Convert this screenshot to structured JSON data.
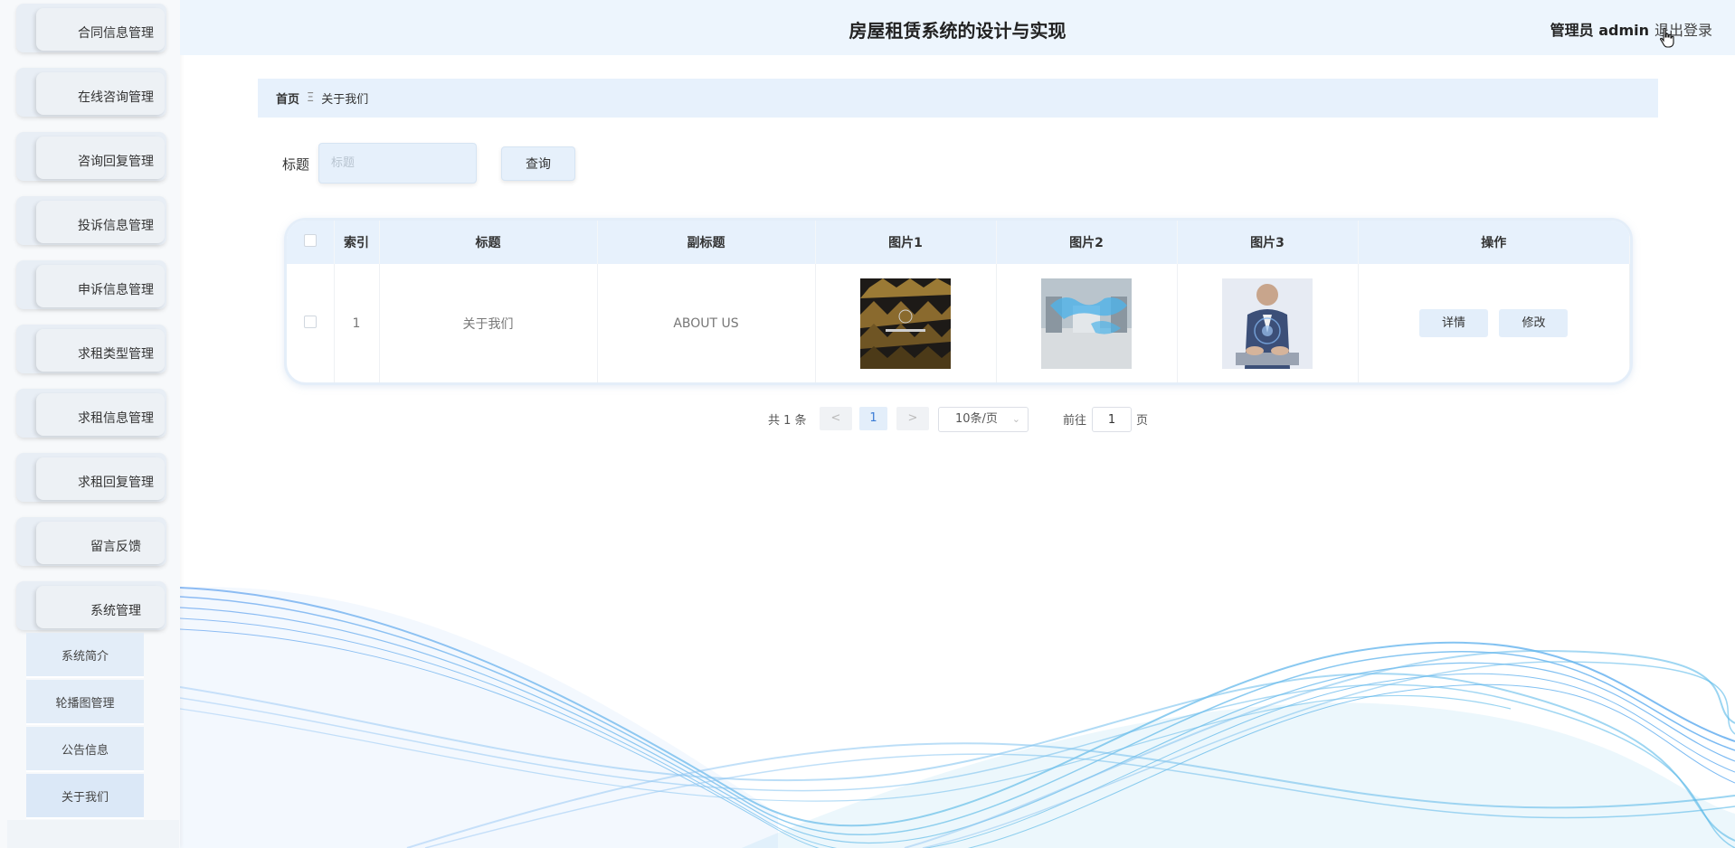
{
  "app": {
    "title": "房屋租赁系统的设计与实现",
    "user_label": "管理员 admin",
    "logout_label": "退出登录"
  },
  "sidebar": {
    "menus": [
      {
        "label": "合同信息管理"
      },
      {
        "label": "在线咨询管理"
      },
      {
        "label": "咨询回复管理"
      },
      {
        "label": "投诉信息管理"
      },
      {
        "label": "申诉信息管理"
      },
      {
        "label": "求租类型管理"
      },
      {
        "label": "求租信息管理"
      },
      {
        "label": "求租回复管理"
      },
      {
        "label": "留言反馈"
      },
      {
        "label": "系统管理"
      }
    ],
    "submenus": [
      {
        "label": "系统简介"
      },
      {
        "label": "轮播图管理"
      },
      {
        "label": "公告信息"
      },
      {
        "label": "关于我们"
      }
    ]
  },
  "breadcrumb": {
    "home": "首页",
    "separator": "Ξ",
    "current": "关于我们"
  },
  "search": {
    "label": "标题",
    "placeholder": "标题",
    "button": "查询"
  },
  "table": {
    "headers": {
      "index": "索引",
      "title": "标题",
      "subtitle": "副标题",
      "pic1": "图片1",
      "pic2": "图片2",
      "pic3": "图片3",
      "actions": "操作"
    },
    "rows": [
      {
        "index": "1",
        "title": "关于我们",
        "subtitle": "ABOUT US",
        "actions": {
          "detail": "详情",
          "edit": "修改"
        }
      }
    ]
  },
  "pagination": {
    "total": "共 1 条",
    "prev": "<",
    "page": "1",
    "next": ">",
    "page_size": "10条/页",
    "goto_label": "前往",
    "goto_value": "1",
    "goto_unit": "页"
  },
  "colors": {
    "accent": "#3a7bd5",
    "header_bg": "#edf5fd",
    "table_header_bg": "#e7f1fc",
    "wave_blue": "#4f9bea"
  }
}
